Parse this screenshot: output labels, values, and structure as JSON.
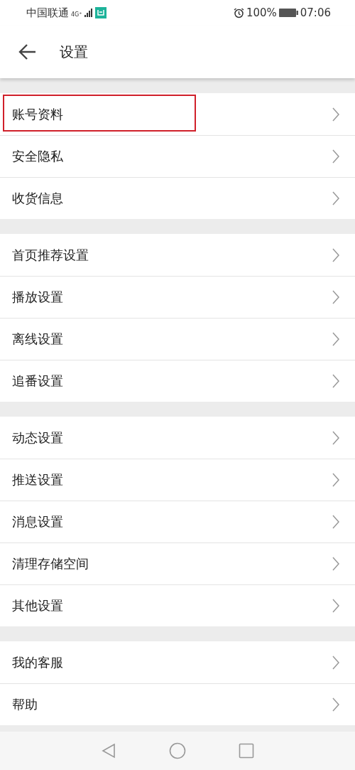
{
  "status_bar": {
    "carrier": "中国联通",
    "network": "4G⁺",
    "battery": "100%",
    "time": "07:06"
  },
  "header": {
    "title": "设置"
  },
  "sections": [
    {
      "items": [
        {
          "label": "账号资料",
          "highlighted": true
        },
        {
          "label": "安全隐私",
          "highlighted": false
        },
        {
          "label": "收货信息",
          "highlighted": false
        }
      ]
    },
    {
      "items": [
        {
          "label": "首页推荐设置",
          "highlighted": false
        },
        {
          "label": "播放设置",
          "highlighted": false
        },
        {
          "label": "离线设置",
          "highlighted": false
        },
        {
          "label": "追番设置",
          "highlighted": false
        }
      ]
    },
    {
      "items": [
        {
          "label": "动态设置",
          "highlighted": false
        },
        {
          "label": "推送设置",
          "highlighted": false
        },
        {
          "label": "消息设置",
          "highlighted": false
        },
        {
          "label": "清理存储空间",
          "highlighted": false
        },
        {
          "label": "其他设置",
          "highlighted": false
        }
      ]
    },
    {
      "items": [
        {
          "label": "我的客服",
          "highlighted": false
        },
        {
          "label": "帮助",
          "highlighted": false
        }
      ]
    }
  ]
}
